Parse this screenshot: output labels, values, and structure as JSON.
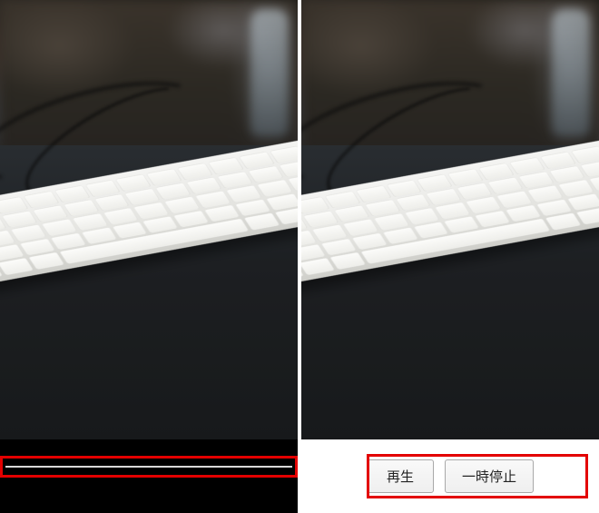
{
  "leftPanel": {
    "controlBar": "scrub"
  },
  "rightPanel": {
    "buttons": {
      "play": "再生",
      "pause": "一時停止"
    }
  }
}
